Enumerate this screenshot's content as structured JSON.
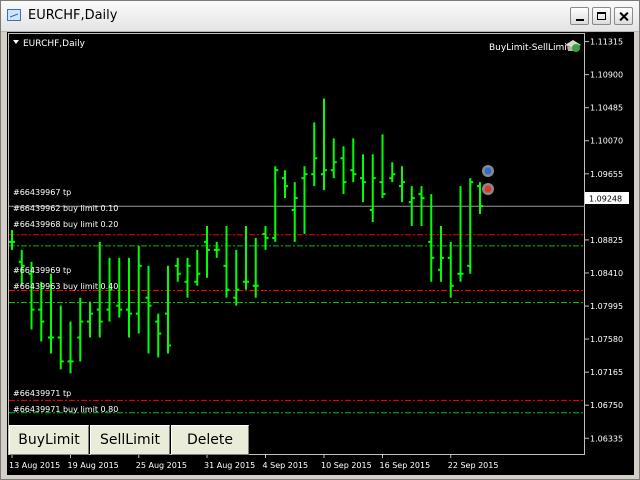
{
  "window": {
    "title": "EURCHF,Daily",
    "icon": "chart-window-icon",
    "controls": [
      "minimize-icon",
      "maximize-icon",
      "close-icon"
    ]
  },
  "chart_label": "EURCHF,Daily",
  "expert": {
    "name": "BuyLimit-SellLimit",
    "icon": "expert-hat-icon"
  },
  "price_axis": {
    "ticks": [
      "1.11315",
      "1.10900",
      "1.10485",
      "1.10070",
      "1.09655",
      "1.08825",
      "1.08410",
      "1.07995",
      "1.07580",
      "1.07165",
      "1.06750",
      "1.06335"
    ],
    "current_price": "1.09248"
  },
  "time_axis": {
    "ticks": [
      "13 Aug 2015",
      "19 Aug 2015",
      "25 Aug 2015",
      "31 Aug 2015",
      "4 Sep 2015",
      "10 Sep 2015",
      "16 Sep 2015",
      "22 Sep 2015"
    ]
  },
  "order_labels": [
    "#66439967 tp",
    "#66439962 buy limit 0.10",
    "#66439968 buy limit 0.20",
    "#66439969 tp",
    "#66439963 buy limit 0.40",
    "#66439971 tp",
    "#66439971 buy limit 0.80"
  ],
  "buttons": {
    "buylimit": "BuyLimit",
    "selllimit": "SellLimit",
    "delete": "Delete"
  },
  "colors": {
    "background": "#000000",
    "bars": "#00ff00",
    "tp_line": "#ff0000",
    "order_line": "#00c000",
    "text": "#ffffff",
    "button_face": "#e8ecd8"
  },
  "chart_data": {
    "type": "ohlc",
    "symbol": "EURCHF",
    "timeframe": "Daily",
    "ylim": [
      1.0615,
      1.1141
    ],
    "current_price": 1.09248,
    "x_ticks": [
      "13 Aug 2015",
      "19 Aug 2015",
      "25 Aug 2015",
      "31 Aug 2015",
      "4 Sep 2015",
      "10 Sep 2015",
      "16 Sep 2015",
      "22 Sep 2015"
    ],
    "bars": [
      {
        "o": 1.088,
        "h": 1.0895,
        "l": 1.087,
        "c": 1.088
      },
      {
        "o": 1.0855,
        "h": 1.087,
        "l": 1.0825,
        "c": 1.085
      },
      {
        "o": 1.084,
        "h": 1.0855,
        "l": 1.077,
        "c": 1.0795
      },
      {
        "o": 1.0795,
        "h": 1.083,
        "l": 1.0755,
        "c": 1.078
      },
      {
        "o": 1.076,
        "h": 1.084,
        "l": 1.074,
        "c": 1.076
      },
      {
        "o": 1.076,
        "h": 1.08,
        "l": 1.072,
        "c": 1.073
      },
      {
        "o": 1.073,
        "h": 1.078,
        "l": 1.0715,
        "c": 1.073
      },
      {
        "o": 1.076,
        "h": 1.081,
        "l": 1.073,
        "c": 1.078
      },
      {
        "o": 1.078,
        "h": 1.0805,
        "l": 1.076,
        "c": 1.079
      },
      {
        "o": 1.0795,
        "h": 1.088,
        "l": 1.076,
        "c": 1.078
      },
      {
        "o": 1.0795,
        "h": 1.086,
        "l": 1.078,
        "c": 1.082
      },
      {
        "o": 1.08,
        "h": 1.086,
        "l": 1.0785,
        "c": 1.0795
      },
      {
        "o": 1.0795,
        "h": 1.086,
        "l": 1.076,
        "c": 1.079
      },
      {
        "o": 1.079,
        "h": 1.0875,
        "l": 1.0765,
        "c": 1.085
      },
      {
        "o": 1.081,
        "h": 1.085,
        "l": 1.074,
        "c": 1.08
      },
      {
        "o": 1.078,
        "h": 1.079,
        "l": 1.0735,
        "c": 1.0765
      },
      {
        "o": 1.079,
        "h": 1.085,
        "l": 1.074,
        "c": 1.075
      },
      {
        "o": 1.085,
        "h": 1.086,
        "l": 1.083,
        "c": 1.084
      },
      {
        "o": 1.083,
        "h": 1.086,
        "l": 1.081,
        "c": 1.085
      },
      {
        "o": 1.083,
        "h": 1.087,
        "l": 1.0825,
        "c": 1.084
      },
      {
        "o": 1.088,
        "h": 1.09,
        "l": 1.0835,
        "c": 1.087
      },
      {
        "o": 1.087,
        "h": 1.088,
        "l": 1.086,
        "c": 1.087
      },
      {
        "o": 1.085,
        "h": 1.09,
        "l": 1.081,
        "c": 1.082
      },
      {
        "o": 1.081,
        "h": 1.087,
        "l": 1.08,
        "c": 1.082
      },
      {
        "o": 1.083,
        "h": 1.09,
        "l": 1.082,
        "c": 1.083
      },
      {
        "o": 1.0825,
        "h": 1.0885,
        "l": 1.081,
        "c": 1.0825
      },
      {
        "o": 1.089,
        "h": 1.09,
        "l": 1.087,
        "c": 1.0885
      },
      {
        "o": 1.0885,
        "h": 1.0975,
        "l": 1.088,
        "c": 1.097
      },
      {
        "o": 1.096,
        "h": 1.097,
        "l": 1.0935,
        "c": 1.095
      },
      {
        "o": 1.092,
        "h": 1.0955,
        "l": 1.088,
        "c": 1.0935
      },
      {
        "o": 1.096,
        "h": 1.0975,
        "l": 1.089,
        "c": 1.0965
      },
      {
        "o": 1.0965,
        "h": 1.103,
        "l": 1.095,
        "c": 1.0985
      },
      {
        "o": 1.0965,
        "h": 1.106,
        "l": 1.0945,
        "c": 1.097
      },
      {
        "o": 1.097,
        "h": 1.101,
        "l": 1.096,
        "c": 1.098
      },
      {
        "o": 1.0985,
        "h": 1.1,
        "l": 1.094,
        "c": 1.0955
      },
      {
        "o": 1.097,
        "h": 1.101,
        "l": 1.0955,
        "c": 1.0965
      },
      {
        "o": 1.096,
        "h": 1.099,
        "l": 1.093,
        "c": 1.0955
      },
      {
        "o": 1.092,
        "h": 1.099,
        "l": 1.0905,
        "c": 1.096
      },
      {
        "o": 1.0955,
        "h": 1.1015,
        "l": 1.0935,
        "c": 1.094
      },
      {
        "o": 1.096,
        "h": 1.098,
        "l": 1.0955,
        "c": 1.0965
      },
      {
        "o": 1.095,
        "h": 1.0975,
        "l": 1.093,
        "c": 1.0955
      },
      {
        "o": 1.093,
        "h": 1.095,
        "l": 1.09,
        "c": 1.0935
      },
      {
        "o": 1.094,
        "h": 1.095,
        "l": 1.09,
        "c": 1.0935
      },
      {
        "o": 1.088,
        "h": 1.094,
        "l": 1.083,
        "c": 1.086
      },
      {
        "o": 1.0845,
        "h": 1.09,
        "l": 1.083,
        "c": 1.086
      },
      {
        "o": 1.086,
        "h": 1.088,
        "l": 1.081,
        "c": 1.0825
      },
      {
        "o": 1.084,
        "h": 1.095,
        "l": 1.083,
        "c": 1.084
      },
      {
        "o": 1.085,
        "h": 1.096,
        "l": 1.084,
        "c": 1.0955
      },
      {
        "o": 1.095,
        "h": 1.0955,
        "l": 1.0915,
        "c": 1.0925
      }
    ],
    "tp_levels": [
      1.0889,
      1.0819,
      1.0681
    ],
    "order_levels": [
      1.0875,
      1.0804,
      1.06655
    ],
    "reference_level": 1.09248
  }
}
